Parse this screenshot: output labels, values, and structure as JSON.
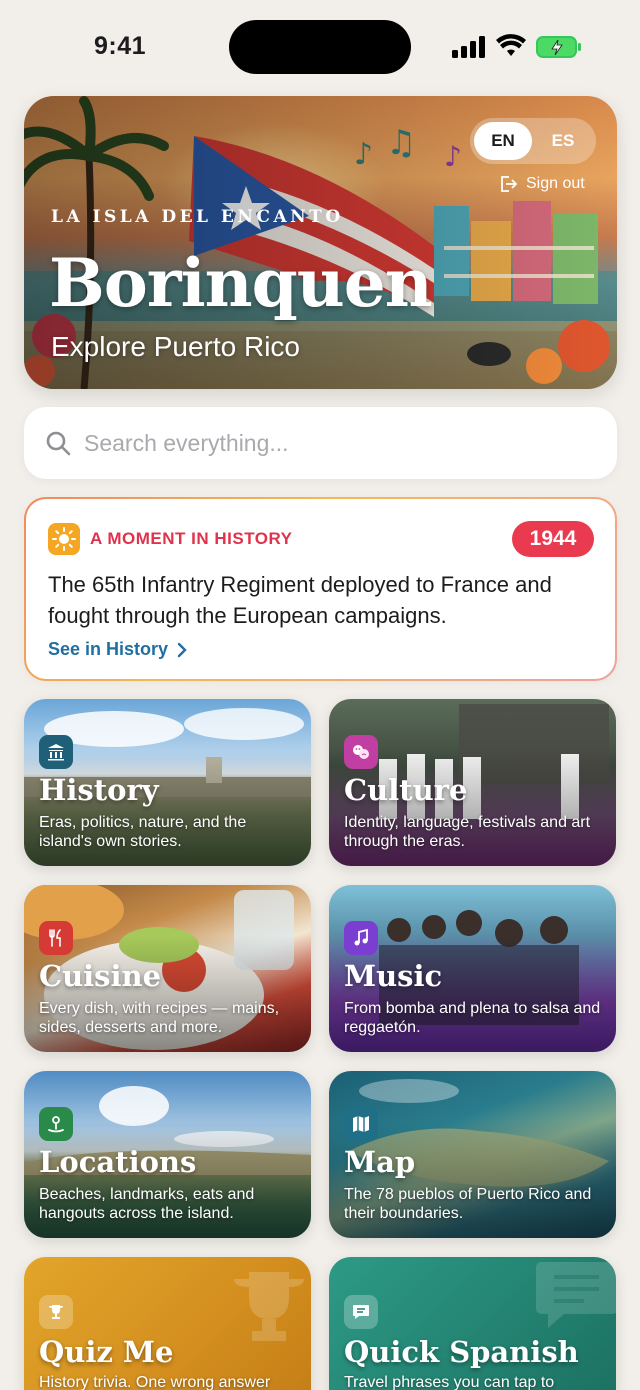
{
  "status_bar": {
    "time": "9:41"
  },
  "hero": {
    "eyebrow": "LA ISLA DEL ENCANTO",
    "title": "Borinquen",
    "subtitle": "Explore Puerto Rico",
    "languages": [
      "EN",
      "ES"
    ],
    "active_language": "EN",
    "sign_out_label": "Sign out"
  },
  "search": {
    "placeholder": "Search everything..."
  },
  "moment": {
    "label": "A MOMENT IN HISTORY",
    "year": "1944",
    "text": "The 65th Infantry Regiment deployed to France and fought through the European campaigns.",
    "link_label": "See in History"
  },
  "tiles": [
    {
      "title": "History",
      "description": "Eras, politics, nature, and the island's own stories.",
      "icon": "museum-icon",
      "color": "#1f5f77"
    },
    {
      "title": "Culture",
      "description": "Identity, language, festivals and art through the eras.",
      "icon": "theater-masks-icon",
      "color": "#c13fa3"
    },
    {
      "title": "Cuisine",
      "description": "Every dish, with recipes — mains, sides, desserts and more.",
      "icon": "fork-knife-icon",
      "color": "#d63a34"
    },
    {
      "title": "Music",
      "description": "From bomba and plena to salsa and reggaetón.",
      "icon": "music-note-icon",
      "color": "#7a3fd0"
    },
    {
      "title": "Locations",
      "description": "Beaches, landmarks, eats and hangouts across the island.",
      "icon": "map-pin-icon",
      "color": "#2a8a4a"
    },
    {
      "title": "Map",
      "description": "The 78 pueblos of Puerto Rico and their boundaries.",
      "icon": "map-icon",
      "color": "#1f6f86"
    },
    {
      "title": "Quiz Me",
      "description": "History trivia. One wrong answer",
      "icon": "trophy-icon",
      "color": "#c98a14"
    },
    {
      "title": "Quick Spanish",
      "description": "Travel phrases you can tap to",
      "icon": "speech-bubble-icon",
      "color": "#1d7d6c"
    }
  ]
}
